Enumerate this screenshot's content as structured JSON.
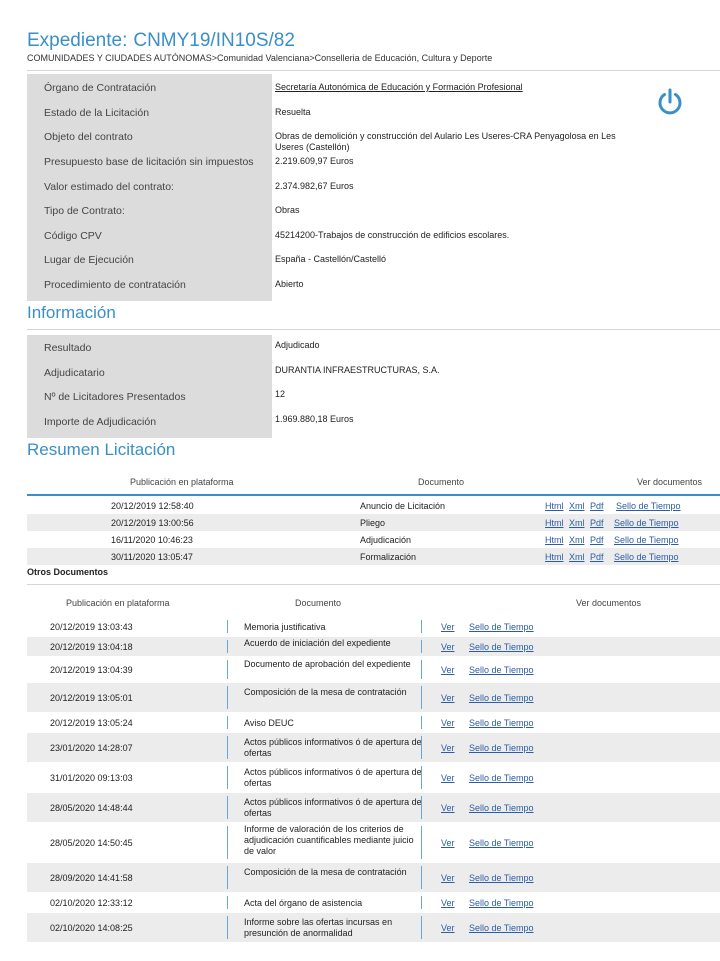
{
  "header": {
    "label": "Expediente:",
    "code": "CNMY19/IN10S/82",
    "breadcrumb": "COMUNIDADES Y CIUDADES AUTÓNOMAS>Comunidad Valenciana>Conselleria de Educación, Cultura y Deporte",
    "power_icon": "power-icon",
    "accent": "#3a8fc8"
  },
  "details": [
    {
      "label": "Órgano de Contratación",
      "value": "Secretaría Autonómica de Educación y Formación Profesional"
    },
    {
      "label": "Estado de la Licitación",
      "value": "Resuelta"
    },
    {
      "label": "Objeto del contrato",
      "value": "Obras de demolición y construcción del Aulario Les Useres-CRA Penyagolosa en Les Useres (Castellón)"
    },
    {
      "label": "Presupuesto base de licitación sin impuestos",
      "value": "2.219.609,97   Euros"
    },
    {
      "label": "Valor estimado del contrato:",
      "value": "2.374.982,67   Euros"
    },
    {
      "label": "Tipo de Contrato:",
      "value": "Obras"
    },
    {
      "label": "Código CPV",
      "value": "45214200-Trabajos de construcción de edificios escolares."
    },
    {
      "label": "Lugar de Ejecución",
      "value": "España - Castellón/Castelló"
    },
    {
      "label": "Procedimiento de contratación",
      "value": "Abierto"
    }
  ],
  "informacion": {
    "title": "Información",
    "rows": [
      {
        "label": "Resultado",
        "value": "Adjudicado"
      },
      {
        "label": "Adjudicatario",
        "value": "DURANTIA INFRAESTRUCTURAS, S.A."
      },
      {
        "label": "Nº de Licitadores Presentados",
        "value": "12"
      },
      {
        "label": "Importe de Adjudicación",
        "value": "1.969.880,18   Euros"
      }
    ]
  },
  "resumen": {
    "title": "Resumen Licitación",
    "headers": [
      "Publicación en plataforma",
      "Documento",
      "Ver documentos"
    ],
    "links": [
      "Html",
      "Xml",
      "Pdf",
      "Sello de Tiempo"
    ],
    "rows": [
      {
        "date": "20/12/2019 12:58:40",
        "doc": "Anuncio de Licitación"
      },
      {
        "date": "20/12/2019 13:00:56",
        "doc": "Pliego"
      },
      {
        "date": "16/11/2020 10:46:23",
        "doc": "Adjudicación"
      },
      {
        "date": "30/11/2020 13:05:47",
        "doc": "Formalización"
      }
    ]
  },
  "otros": {
    "title": "Otros Documentos",
    "headers": [
      "Publicación en plataforma",
      "Documento",
      "Ver documentos"
    ],
    "ver": "Ver",
    "sello": "Sello de Tiempo",
    "rows": [
      {
        "date": "20/12/2019 13:03:43",
        "doc": "Memoria justificativa"
      },
      {
        "date": "20/12/2019 13:04:18",
        "doc": "Acuerdo de iniciación del expediente"
      },
      {
        "date": "20/12/2019 13:04:39",
        "doc": "Documento de aprobación del expediente"
      },
      {
        "date": "20/12/2019 13:05:01",
        "doc": "Composición de la mesa de contratación"
      },
      {
        "date": "20/12/2019 13:05:24",
        "doc": "Aviso DEUC"
      },
      {
        "date": "23/01/2020 14:28:07",
        "doc": "Actos públicos informativos ó de apertura de ofertas"
      },
      {
        "date": "31/01/2020 09:13:03",
        "doc": "Actos públicos informativos ó de apertura de ofertas"
      },
      {
        "date": "28/05/2020 14:48:44",
        "doc": "Actos públicos informativos ó de apertura de ofertas"
      },
      {
        "date": "28/05/2020 14:50:45",
        "doc": "Informe de valoración de los criterios de adjudicación cuantificables mediante juicio de valor"
      },
      {
        "date": "28/09/2020 14:41:58",
        "doc": "Composición de la mesa de contratación"
      },
      {
        "date": "02/10/2020 12:33:12",
        "doc": "Acta del órgano de asistencia"
      },
      {
        "date": "02/10/2020 14:08:25",
        "doc": "Informe sobre las ofertas incursas en presunción de anormalidad"
      }
    ]
  }
}
